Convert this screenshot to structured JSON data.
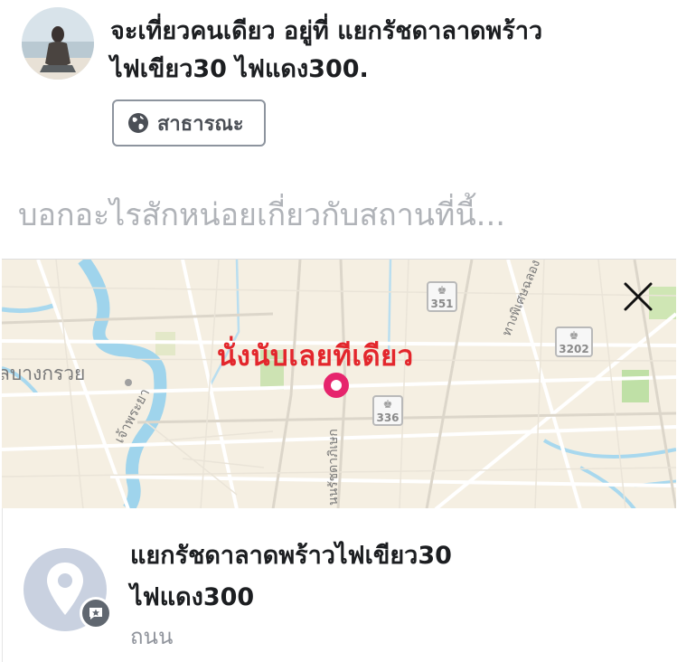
{
  "post": {
    "header_line1": "จะเที่ยวคนเดียว อยู่ที่ แยกรัชดาลาดพร้าว",
    "header_line2": "ไฟเขียว30 ไฟแดง300.",
    "privacy_label": "สาธารณะ",
    "privacy_icon": "globe-icon"
  },
  "composer": {
    "placeholder": "บอกอะไรสักหน่อยเกี่ยวกับสถานที่นี้..."
  },
  "map": {
    "overlay_text": "นั่งนับเลยทีเดียว",
    "close_icon": "close-icon",
    "route_shields": [
      "351",
      "3202",
      "336"
    ],
    "place_labels": [
      "ลบางกรวย",
      "เจ้าพระยา",
      "นนรัชดาภิเษก",
      "ทางพิเศษฉลอง"
    ]
  },
  "place": {
    "title_line1": "แยกรัชดาลาดพร้าวไฟเขียว30",
    "title_line2": "ไฟแดง300",
    "category": "ถนน",
    "icon": "location-pin-icon",
    "badge_icon": "review-icon"
  },
  "colors": {
    "pin": "#e6246c",
    "overlay_text": "#e3262c",
    "map_background": "#f5efe2",
    "river": "#9fd4ec"
  }
}
